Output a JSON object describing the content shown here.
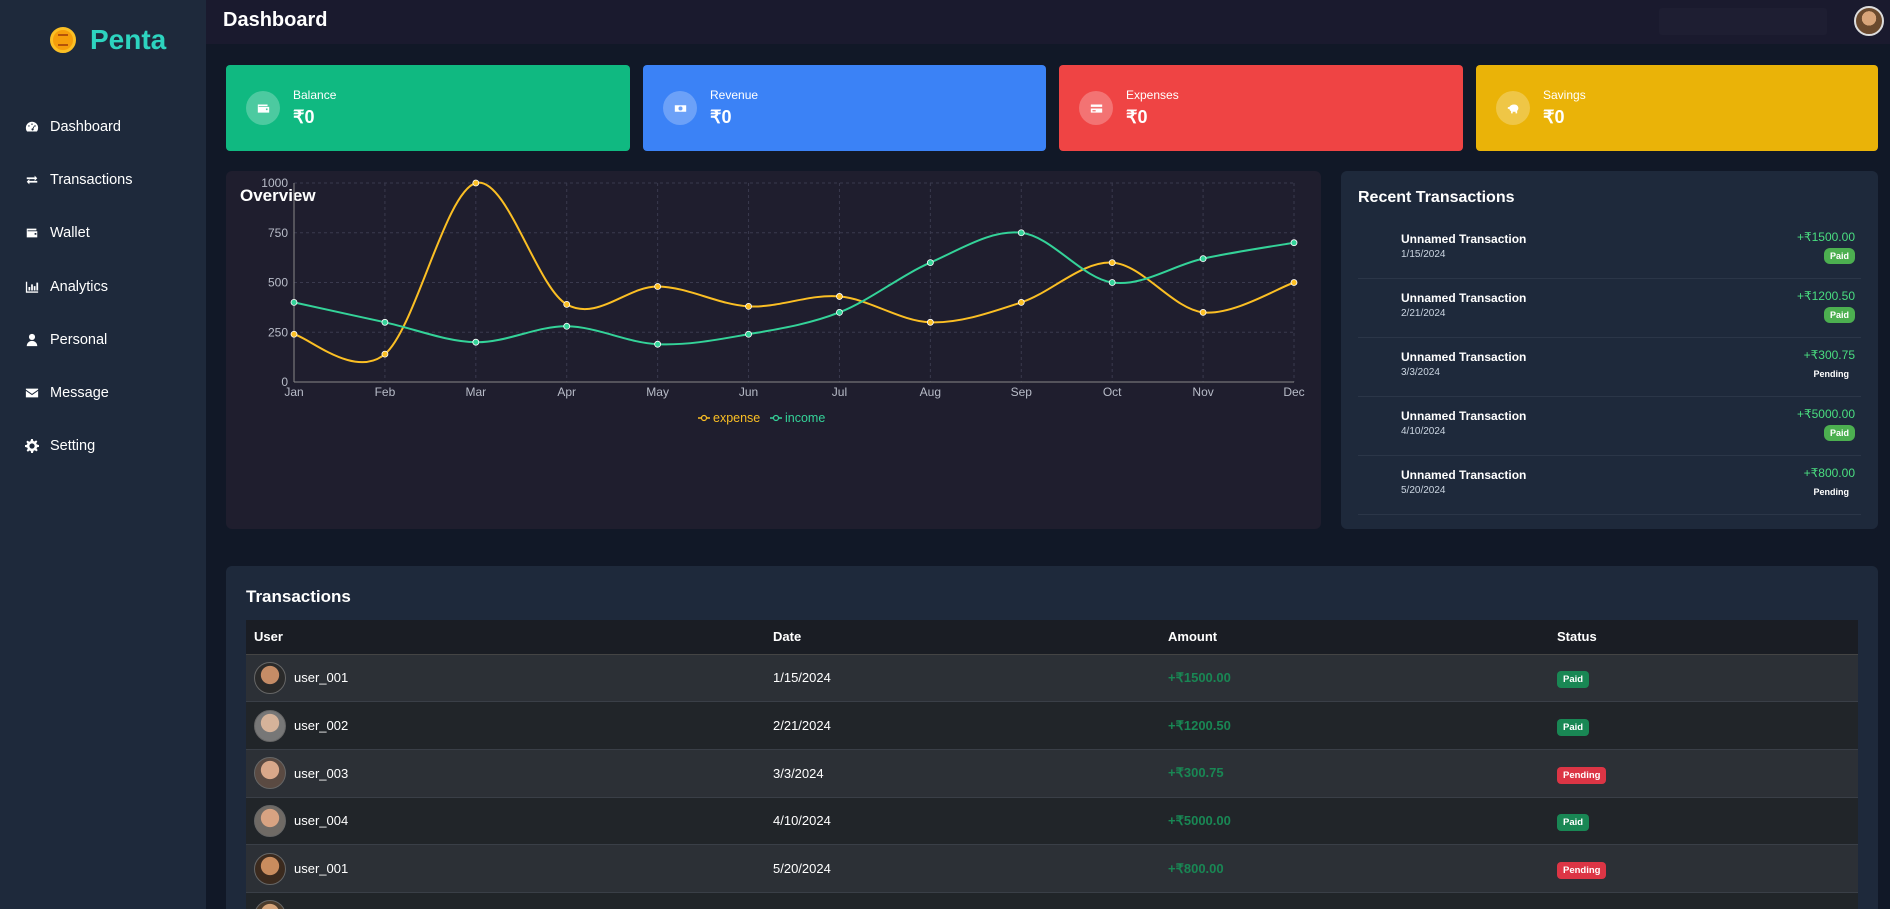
{
  "app": {
    "name": "Penta"
  },
  "nav": [
    {
      "label": "Dashboard",
      "icon": "dashboard-icon"
    },
    {
      "label": "Transactions",
      "icon": "exchange-icon"
    },
    {
      "label": "Wallet",
      "icon": "wallet-icon"
    },
    {
      "label": "Analytics",
      "icon": "bar-chart-icon"
    },
    {
      "label": "Personal",
      "icon": "user-icon"
    },
    {
      "label": "Message",
      "icon": "envelope-icon"
    },
    {
      "label": "Setting",
      "icon": "gear-icon"
    }
  ],
  "header": {
    "title": "Dashboard"
  },
  "cards": [
    {
      "label": "Balance",
      "value": "₹0",
      "color": "#10b981",
      "icon": "wallet-icon"
    },
    {
      "label": "Revenue",
      "value": "₹0",
      "color": "#3b82f6",
      "icon": "money-icon"
    },
    {
      "label": "Expenses",
      "value": "₹0",
      "color": "#ef4444",
      "icon": "credit-card-icon"
    },
    {
      "label": "Savings",
      "value": "₹0",
      "color": "#eab308",
      "icon": "piggy-bank-icon"
    }
  ],
  "overview": {
    "title": "Overview"
  },
  "chart_data": {
    "type": "line",
    "categories": [
      "Jan",
      "Feb",
      "Mar",
      "Apr",
      "May",
      "Jun",
      "Jul",
      "Aug",
      "Sep",
      "Oct",
      "Nov",
      "Dec"
    ],
    "series": [
      {
        "name": "expense",
        "color": "#fbbf24",
        "values": [
          240,
          140,
          1000,
          390,
          480,
          380,
          430,
          300,
          400,
          600,
          350,
          500
        ]
      },
      {
        "name": "income",
        "color": "#34d399",
        "values": [
          400,
          300,
          200,
          280,
          190,
          240,
          350,
          600,
          750,
          500,
          620,
          700
        ]
      }
    ],
    "yticks": [
      0,
      250,
      500,
      750,
      1000
    ],
    "ylim": [
      0,
      1000
    ],
    "grid": true,
    "legend": "bottom"
  },
  "recent": {
    "title": "Recent Transactions",
    "items": [
      {
        "name": "Unnamed Transaction",
        "date": "1/15/2024",
        "amount": "+₹1500.00",
        "status": "Paid"
      },
      {
        "name": "Unnamed Transaction",
        "date": "2/21/2024",
        "amount": "+₹1200.50",
        "status": "Paid"
      },
      {
        "name": "Unnamed Transaction",
        "date": "3/3/2024",
        "amount": "+₹300.75",
        "status": "Pending"
      },
      {
        "name": "Unnamed Transaction",
        "date": "4/10/2024",
        "amount": "+₹5000.00",
        "status": "Paid"
      },
      {
        "name": "Unnamed Transaction",
        "date": "5/20/2024",
        "amount": "+₹800.00",
        "status": "Pending"
      }
    ]
  },
  "transactions": {
    "title": "Transactions",
    "columns": [
      "User",
      "Date",
      "Amount",
      "Status"
    ],
    "rows": [
      {
        "user": "user_001",
        "date": "1/15/2024",
        "amount": "+₹1500.00",
        "status": "Paid"
      },
      {
        "user": "user_002",
        "date": "2/21/2024",
        "amount": "+₹1200.50",
        "status": "Paid"
      },
      {
        "user": "user_003",
        "date": "3/3/2024",
        "amount": "+₹300.75",
        "status": "Pending"
      },
      {
        "user": "user_004",
        "date": "4/10/2024",
        "amount": "+₹5000.00",
        "status": "Paid"
      },
      {
        "user": "user_001",
        "date": "5/20/2024",
        "amount": "+₹800.00",
        "status": "Pending"
      },
      {
        "user": "",
        "date": "",
        "amount": "",
        "status": ""
      }
    ]
  }
}
